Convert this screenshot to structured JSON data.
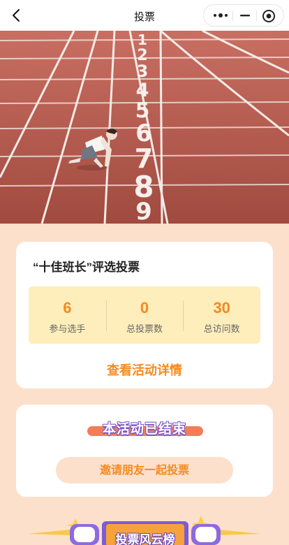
{
  "header": {
    "title": "投票",
    "back_icon": "chevron-left-icon",
    "more_icon": "more-dots-icon",
    "minimize_icon": "minimize-icon",
    "close_icon": "target-close-icon"
  },
  "hero": {
    "image_description": "running-track-photo",
    "lane_numbers": [
      "1",
      "2",
      "3",
      "4",
      "5",
      "6",
      "7",
      "8",
      "9"
    ]
  },
  "event": {
    "title": "“十佳班长”评选投票",
    "stats": [
      {
        "value": "6",
        "label": "参与选手"
      },
      {
        "value": "0",
        "label": "总投票数"
      },
      {
        "value": "30",
        "label": "总访问数"
      }
    ],
    "detail_link": "查看活动详情"
  },
  "status": {
    "ended_text": "本活动已结束",
    "invite_button": "邀请朋友一起投票"
  },
  "leaderboard": {
    "banner_text": "投票风云榜"
  },
  "colors": {
    "page_bg": "#fde0cb",
    "accent_orange": "#f58a1f",
    "stats_bg": "#fdeebb",
    "track_red": "#b4574b",
    "purple_outline": "#7b55c7"
  }
}
